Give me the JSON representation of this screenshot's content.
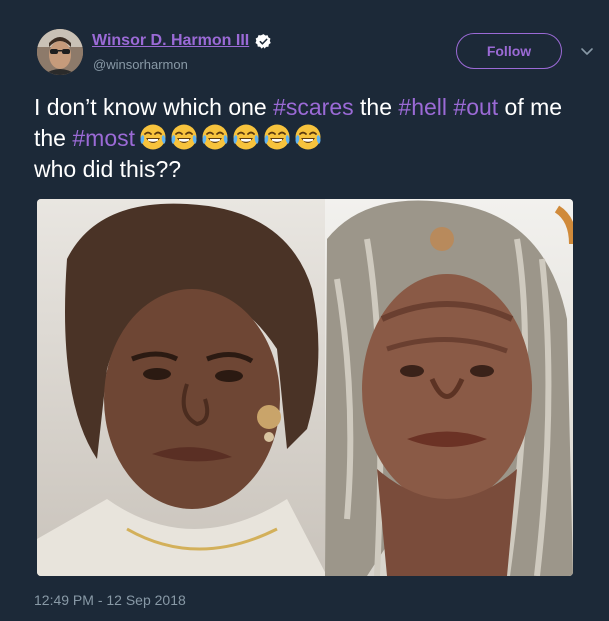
{
  "author": {
    "name": "Winsor D. Harmon III",
    "handle": "@winsorharmon",
    "verified": true,
    "avatar_icon": "profile-avatar"
  },
  "actions": {
    "follow_label": "Follow",
    "menu_icon": "chevron-down-icon"
  },
  "tweet": {
    "segments": [
      {
        "text": "I don’t know which one ",
        "hashtag": false
      },
      {
        "text": "#scares",
        "hashtag": true
      },
      {
        "text": " the ",
        "hashtag": false
      },
      {
        "text": "#hell",
        "hashtag": true
      },
      {
        "text": " ",
        "hashtag": false
      },
      {
        "text": "#out",
        "hashtag": true
      },
      {
        "text": " of me the  ",
        "hashtag": false
      },
      {
        "text": "#most",
        "hashtag": true
      }
    ],
    "emoji": "face-with-tears-of-joy",
    "emoji_count": 6,
    "last_line": "who did this??",
    "media_icon": "tweet-photo",
    "timestamp": "12:49 PM - 12 Sep 2018"
  },
  "colors": {
    "background": "#1c2938",
    "accent": "#9b6ad6",
    "secondary_text": "#8899a6",
    "primary_text": "#ffffff"
  }
}
